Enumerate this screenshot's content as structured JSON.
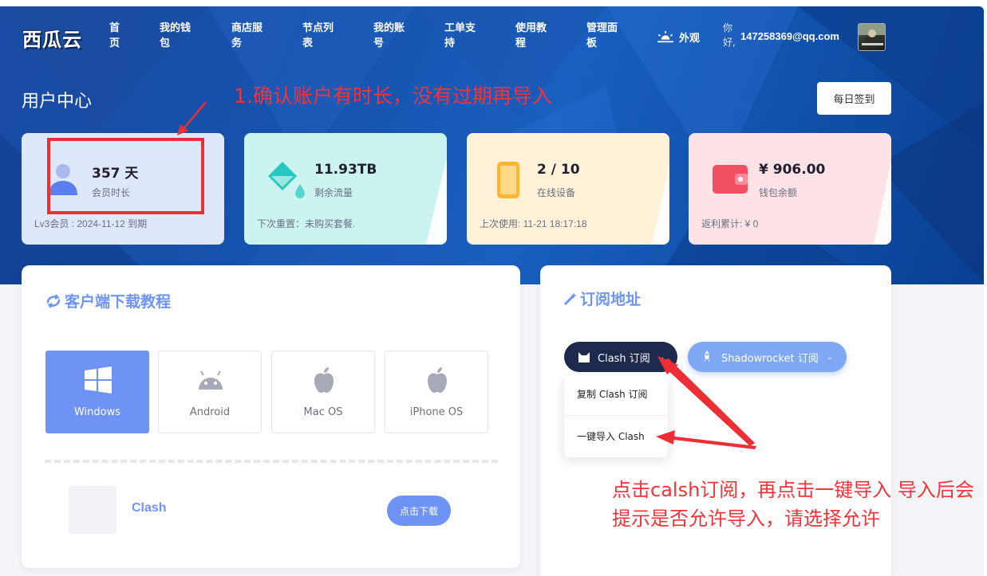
{
  "brand": {
    "logo": "西瓜云"
  },
  "nav": {
    "items": [
      {
        "line1": "首",
        "line2": "页"
      },
      {
        "line1": "我的钱",
        "line2": "包"
      },
      {
        "line1": "商店服",
        "line2": "务"
      },
      {
        "line1": "节点列",
        "line2": "表"
      },
      {
        "line1": "我的账",
        "line2": "号"
      },
      {
        "line1": "工单支",
        "line2": "持"
      },
      {
        "line1": "使用教",
        "line2": "程"
      },
      {
        "line1": "管理面",
        "line2": "板"
      }
    ],
    "appearance": "外观",
    "greeting": "你好,",
    "email": "147258369@qq.com"
  },
  "header": {
    "title": "用户中心",
    "checkin_button": "每日签到"
  },
  "annotations": {
    "note1": "1.确认账户有时长，没有过期再导入",
    "note2": "点击calsh订阅，再点击一键导入 导入后会提示是否允许导入，请选择允许"
  },
  "stats": {
    "member": {
      "value": "357 天",
      "label": "会员时长",
      "footer": "Lv3会员 : 2024-11-12 到期"
    },
    "traffic": {
      "value": "11.93TB",
      "label": "剩余流量",
      "footer": "下次重置：未购买套餐."
    },
    "devices": {
      "value": "2 / 10",
      "label": "在线设备",
      "footer": "上次使用: 11-21 18:17:18"
    },
    "wallet": {
      "value": "¥ 906.00",
      "label": "钱包余额",
      "footer": "返利累计: ¥ 0"
    }
  },
  "download": {
    "title": "客户端下载教程",
    "os_tabs": [
      "Windows",
      "Android",
      "Mac OS",
      "iPhone OS"
    ],
    "selected": "Windows",
    "app_name": "Clash",
    "download_button": "点击下载"
  },
  "subscription": {
    "title": "订阅地址",
    "clash_button": "Clash 订阅",
    "shadowrocket_button": "Shadowrocket 订阅",
    "dropdown": [
      "复制 Clash 订阅",
      "一键导入 Clash"
    ]
  },
  "colors": {
    "accent": "#6f93f5",
    "annotation": "#f2333a",
    "banner": "#1552ad",
    "dark_button": "#1d2a4d"
  }
}
